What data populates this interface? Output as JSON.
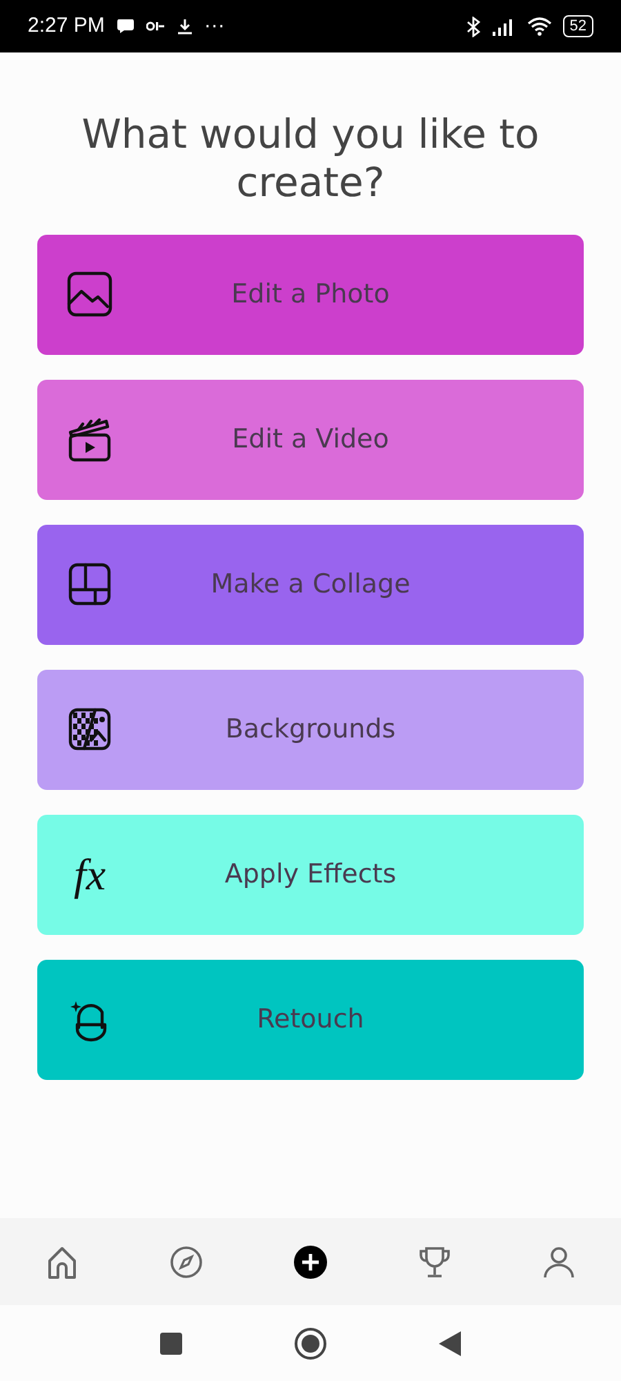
{
  "status_bar": {
    "time": "2:27 PM",
    "ellipsis": "···",
    "battery": "52"
  },
  "title": "What would you like to create?",
  "options": [
    {
      "label": "Edit a Photo",
      "kind": "photo",
      "color": "#cc3fcc"
    },
    {
      "label": "Edit a Video",
      "kind": "video",
      "color": "#da6bd9"
    },
    {
      "label": "Make a Collage",
      "kind": "collage",
      "color": "#9964ee"
    },
    {
      "label": "Backgrounds",
      "kind": "background",
      "color": "#bb9cf4"
    },
    {
      "label": "Apply Effects",
      "kind": "fx",
      "glyph": "fx",
      "color": "#76fbe6"
    },
    {
      "label": "Retouch",
      "kind": "retouch",
      "color": "#00c5c0"
    }
  ],
  "nav": [
    {
      "kind": "home",
      "selected": false
    },
    {
      "kind": "compass",
      "selected": false
    },
    {
      "kind": "create",
      "selected": true
    },
    {
      "kind": "trophy",
      "selected": false
    },
    {
      "kind": "profile",
      "selected": false
    }
  ]
}
